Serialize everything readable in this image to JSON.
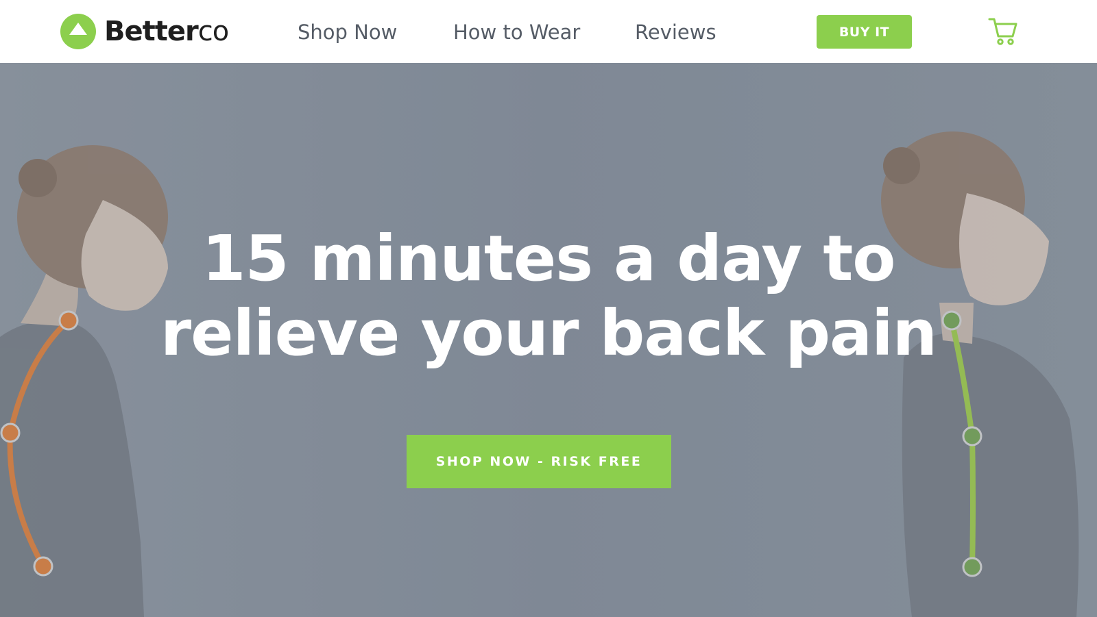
{
  "brand": {
    "name_bold": "Better",
    "name_light": "co",
    "accent_color": "#8ccf4d"
  },
  "nav": {
    "links": [
      {
        "label": "Shop Now"
      },
      {
        "label": "How to Wear"
      },
      {
        "label": "Reviews"
      }
    ],
    "buy_label": "BUY IT",
    "cart_icon": "shopping-cart-icon"
  },
  "hero": {
    "headline_line1": "15 minutes a day to",
    "headline_line2": "relieve your back pain",
    "cta_label": "SHOP NOW - RISK FREE",
    "overlay_color": "#7e8895",
    "posture_bad_color": "#e07a2f",
    "posture_good_color": "#8ccf4d"
  }
}
